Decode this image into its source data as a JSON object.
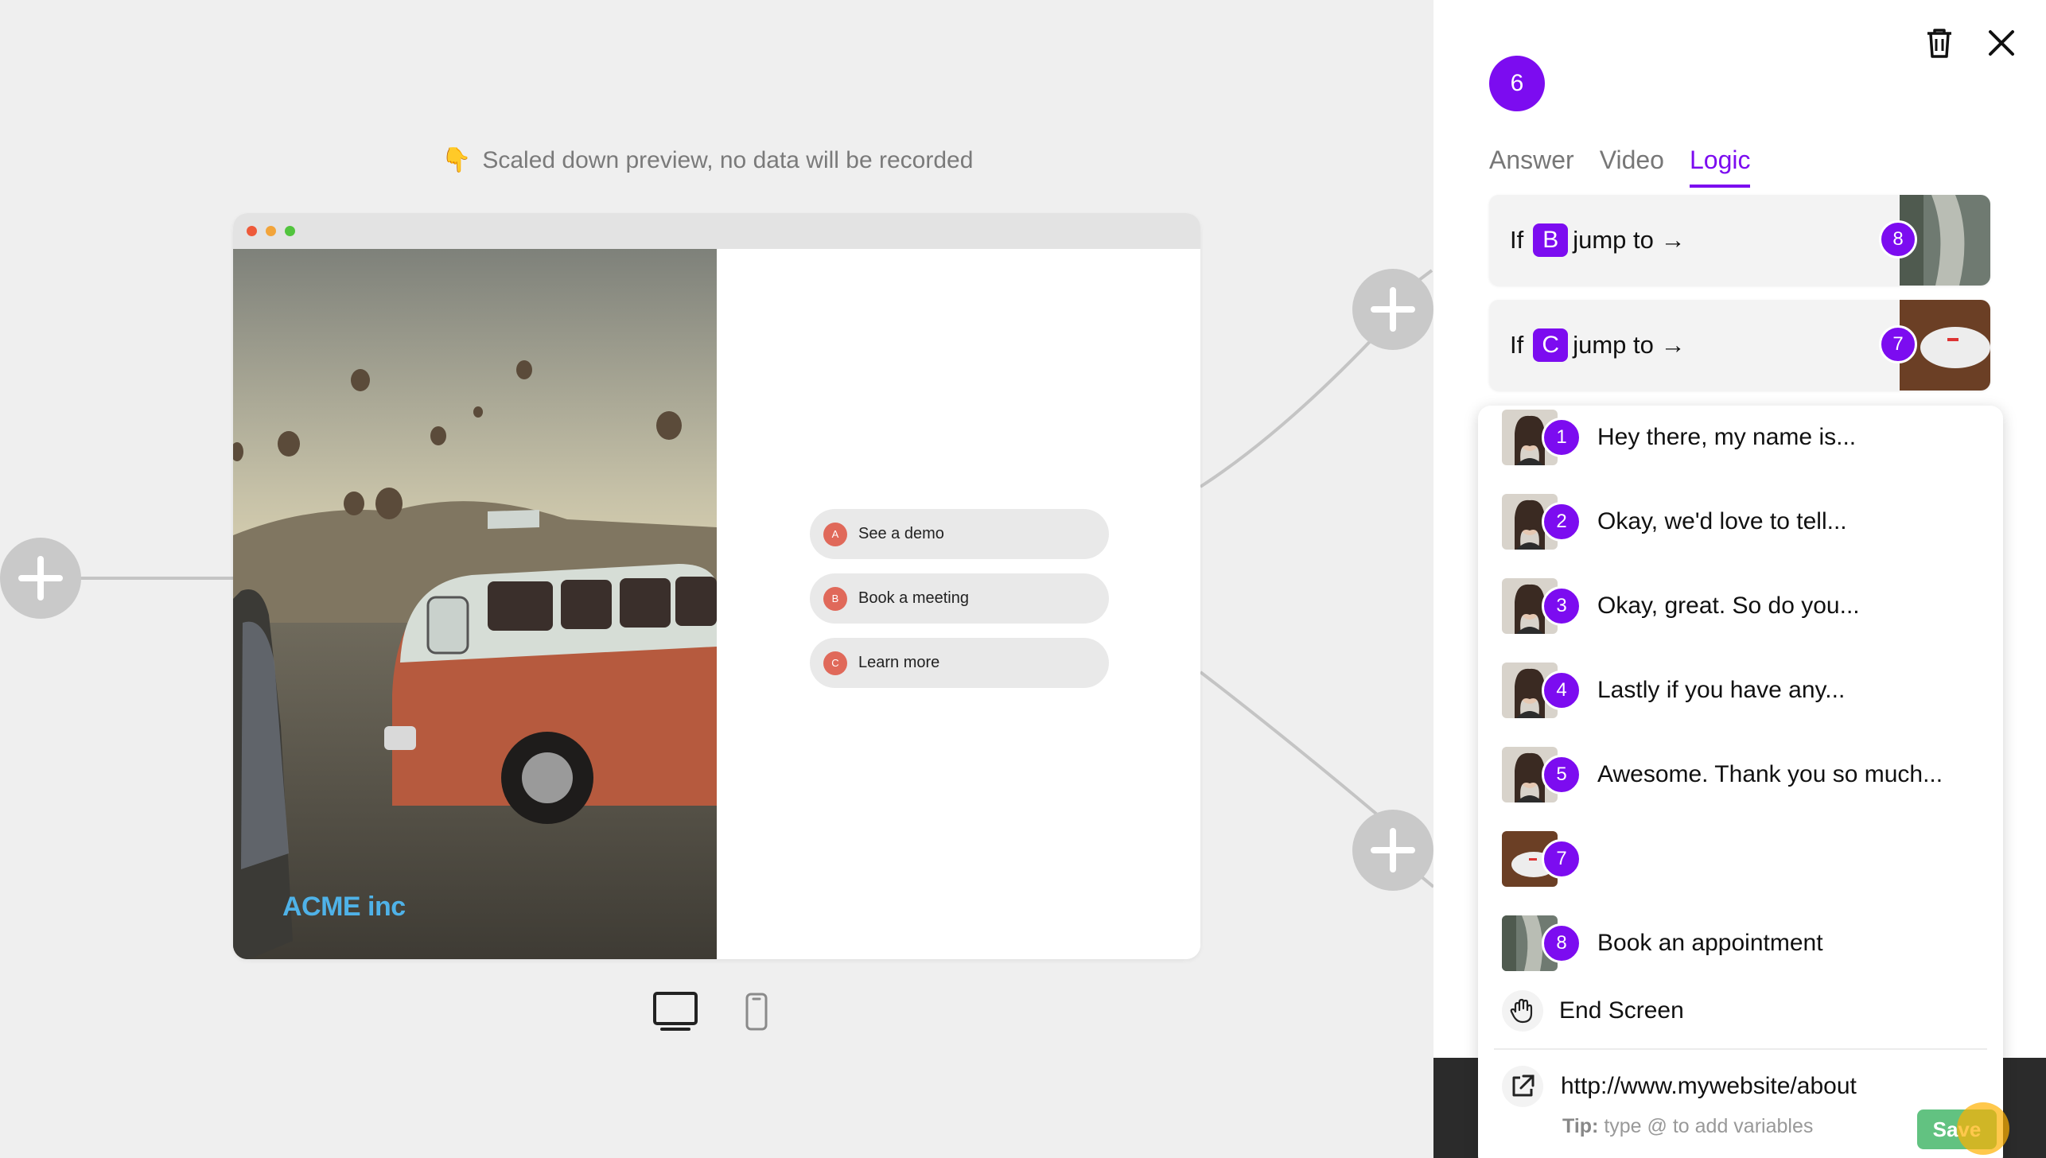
{
  "preview": {
    "notice": "Scaled down preview, no data will be recorded",
    "notice_icon": "👇",
    "brand": "ACME inc",
    "choices": [
      {
        "letter": "A",
        "label": "See a demo"
      },
      {
        "letter": "B",
        "label": "Book a meeting"
      },
      {
        "letter": "C",
        "label": "Learn more"
      }
    ]
  },
  "panel": {
    "step_number": "6",
    "tabs": [
      "Answer",
      "Video",
      "Logic"
    ],
    "active_tab": "Logic",
    "rules": [
      {
        "prefix": "If",
        "letter": "B",
        "suffix": "jump to →",
        "target": "8"
      },
      {
        "prefix": "If",
        "letter": "C",
        "suffix": "jump to →",
        "target": "7"
      }
    ],
    "dropdown": [
      {
        "num": "1",
        "label": "Hey there, my name is..."
      },
      {
        "num": "2",
        "label": "Okay, we'd love to tell..."
      },
      {
        "num": "3",
        "label": "Okay, great. So do you..."
      },
      {
        "num": "4",
        "label": "Lastly if you have any..."
      },
      {
        "num": "5",
        "label": "Awesome. Thank you so much..."
      },
      {
        "num": "7",
        "label": ""
      },
      {
        "num": "8",
        "label": "Book an appointment"
      }
    ],
    "end_screen": "End Screen",
    "url_value": "http://www.mywebsite/about",
    "tip_label": "Tip:",
    "tip_text": "type @ to add variables",
    "save_label": "Save"
  },
  "colors": {
    "accent": "#7c0cf0",
    "choice_badge": "#e0695a",
    "save": "#62c281",
    "brand": "#4fb2e8"
  },
  "icons": [
    "trash-icon",
    "close-icon",
    "plus-icon",
    "desktop-icon",
    "mobile-icon",
    "wave-hand-icon",
    "external-link-icon"
  ]
}
